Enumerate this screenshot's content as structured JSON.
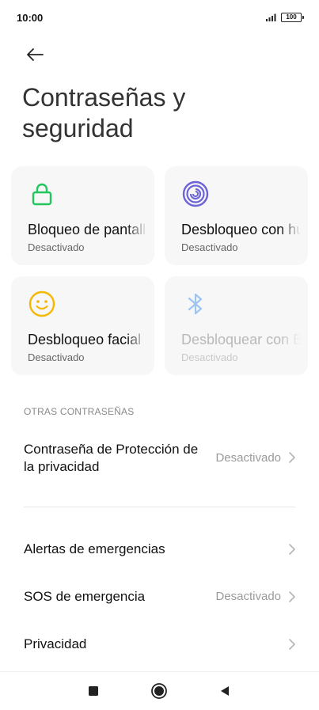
{
  "status_bar": {
    "time": "10:00",
    "signal_icon": "signal-icon",
    "battery": "100"
  },
  "header": {
    "back_icon": "arrow-left-icon",
    "title": "Contraseñas y seguridad"
  },
  "cards": [
    {
      "label": "Bloqueo de pantalla",
      "status": "Desactivado",
      "icon": "lock-icon",
      "icon_color": "#22c55e",
      "enabled": true
    },
    {
      "label": "Desbloqueo con huella",
      "status": "Desactivado",
      "icon": "fingerprint-icon",
      "icon_color": "#6b63d6",
      "enabled": true
    },
    {
      "label": "Desbloqueo facial",
      "status": "Desactivado",
      "icon": "face-icon",
      "icon_color": "#f5b800",
      "enabled": true
    },
    {
      "label": "Desbloquear con Bluetooth",
      "status": "Desactivado",
      "icon": "bluetooth-icon",
      "icon_color": "#9ec4f2",
      "enabled": false
    }
  ],
  "other_passwords": {
    "header": "OTRAS CONTRASEÑAS",
    "items": [
      {
        "title": "Contraseña de Protección de la privacidad",
        "value": "Desactivado"
      }
    ]
  },
  "settings": [
    {
      "title": "Alertas de emergencias",
      "value": ""
    },
    {
      "title": "SOS de emergencia",
      "value": "Desactivado"
    },
    {
      "title": "Privacidad",
      "value": ""
    }
  ],
  "nav": {
    "recents_icon": "square-icon",
    "home_icon": "circle-icon",
    "back_icon": "triangle-back-icon"
  },
  "colors": {
    "lock": "#22c55e",
    "fingerprint": "#6b63d6",
    "face": "#f5b800",
    "bluetooth": "#9ec4f2"
  }
}
